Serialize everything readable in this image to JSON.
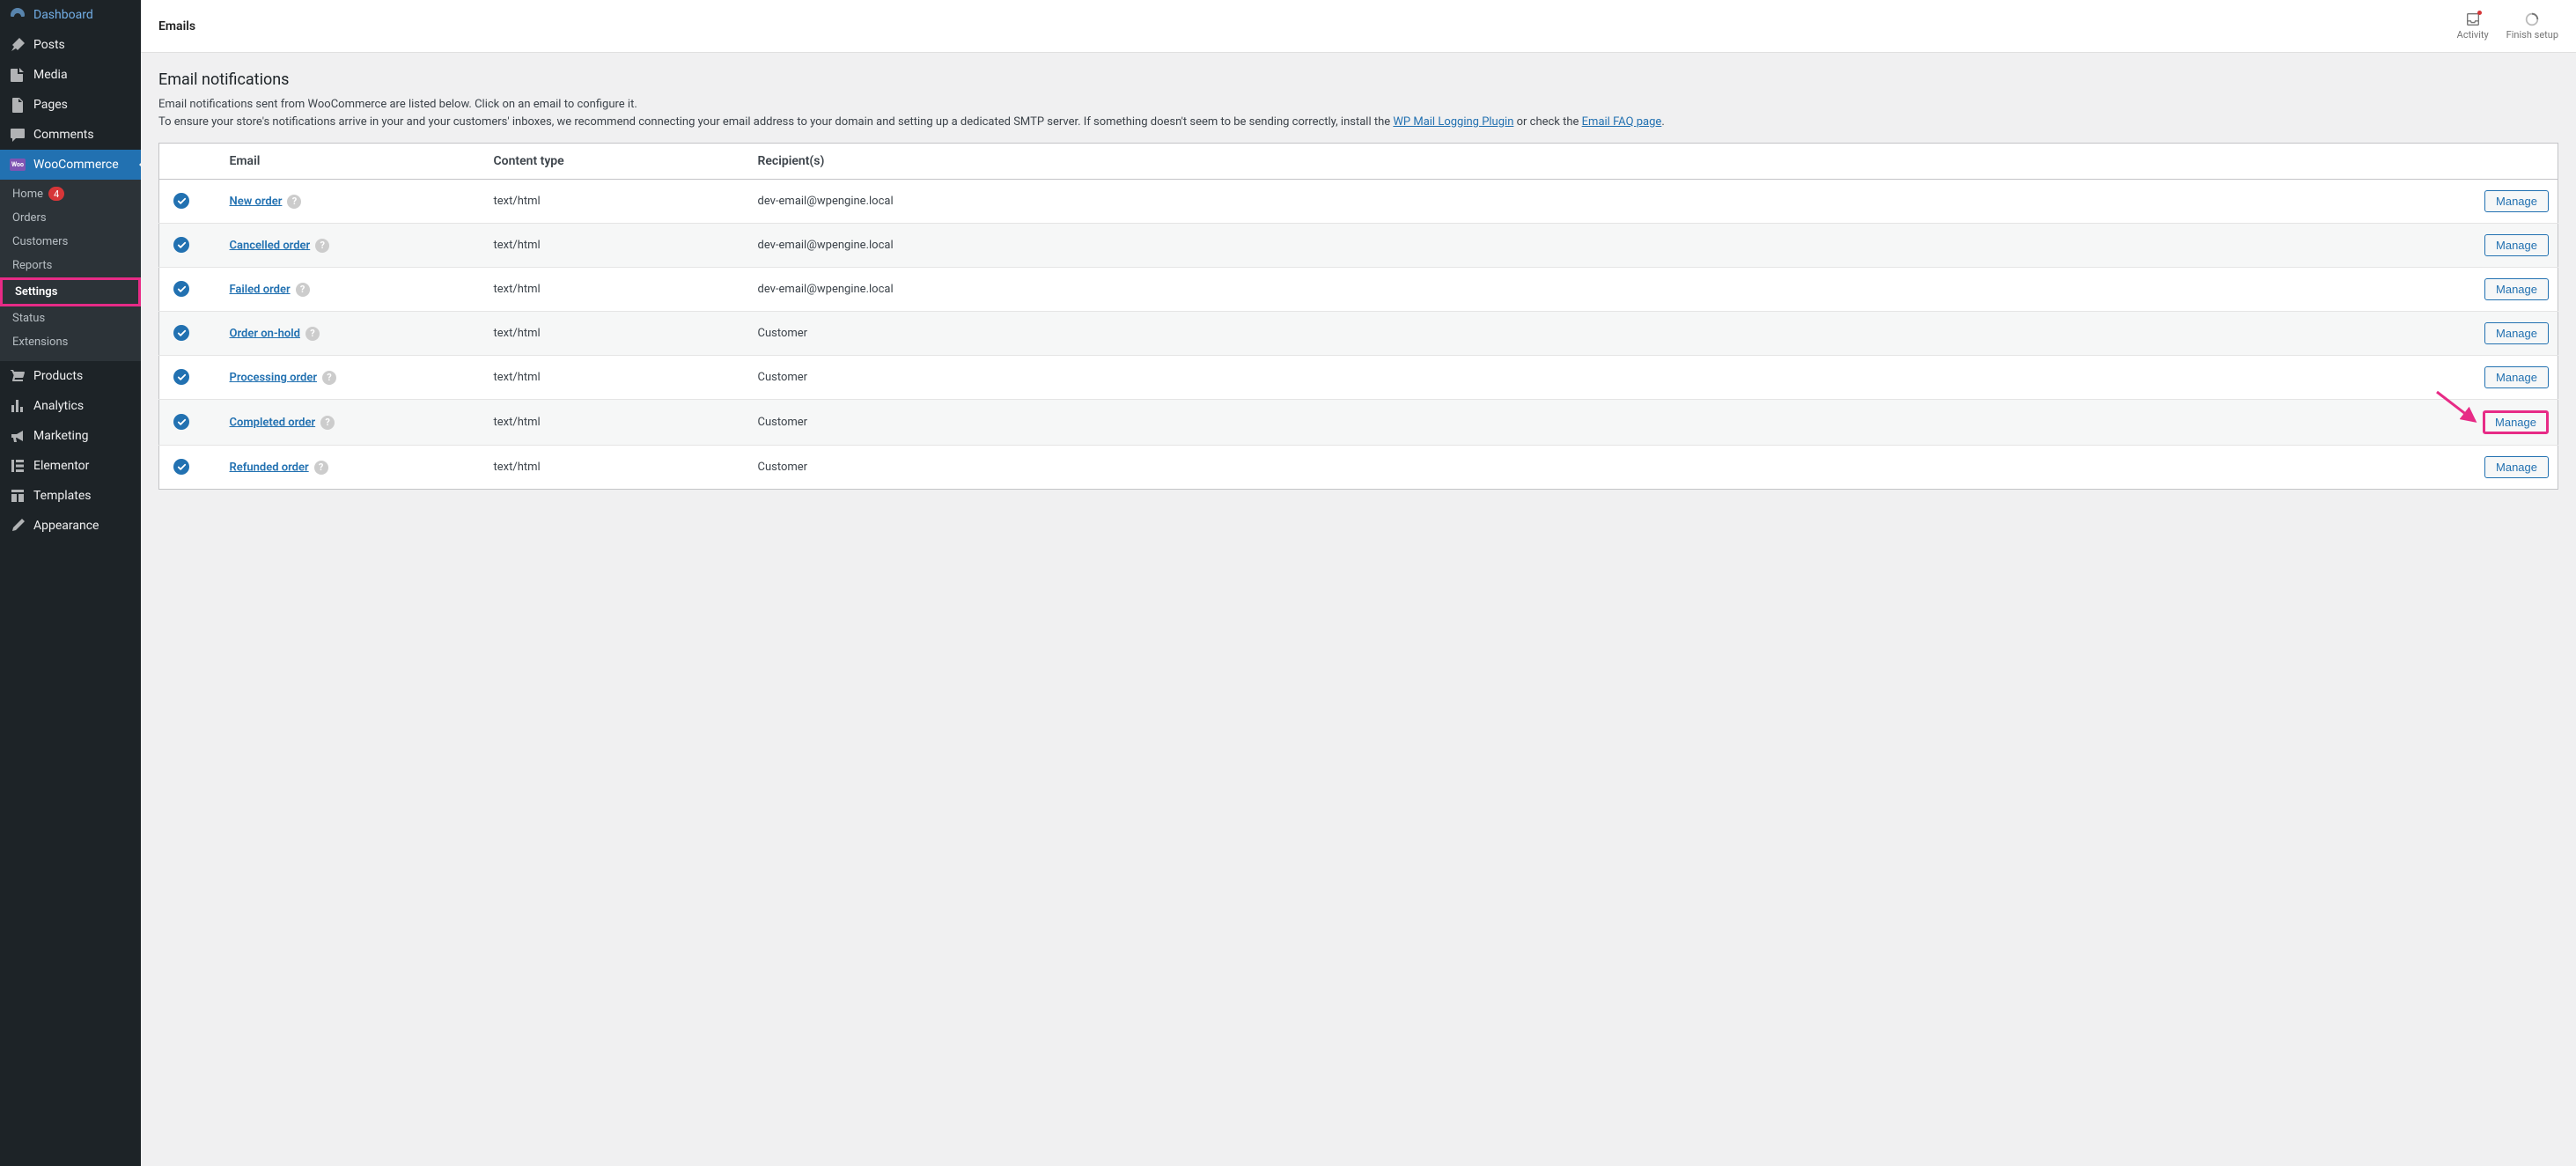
{
  "sidebar": {
    "items": [
      {
        "label": "Dashboard",
        "icon": "dashboard"
      },
      {
        "label": "Posts",
        "icon": "pin"
      },
      {
        "label": "Media",
        "icon": "media"
      },
      {
        "label": "Pages",
        "icon": "pages"
      },
      {
        "label": "Comments",
        "icon": "comments"
      },
      {
        "label": "WooCommerce",
        "icon": "woo",
        "active": true,
        "submenu": [
          {
            "label": "Home",
            "badge": "4"
          },
          {
            "label": "Orders"
          },
          {
            "label": "Customers"
          },
          {
            "label": "Reports"
          },
          {
            "label": "Settings",
            "current": true,
            "highlighted": true
          },
          {
            "label": "Status"
          },
          {
            "label": "Extensions"
          }
        ]
      },
      {
        "label": "Products",
        "icon": "products"
      },
      {
        "label": "Analytics",
        "icon": "analytics"
      },
      {
        "label": "Marketing",
        "icon": "marketing"
      },
      {
        "label": "Elementor",
        "icon": "elementor"
      },
      {
        "label": "Templates",
        "icon": "templates"
      },
      {
        "label": "Appearance",
        "icon": "appearance"
      }
    ]
  },
  "topbar": {
    "title": "Emails",
    "activity_label": "Activity",
    "finish_label": "Finish setup"
  },
  "section": {
    "title": "Email notifications",
    "desc_line1": "Email notifications sent from WooCommerce are listed below. Click on an email to configure it.",
    "desc_line2_pre": "To ensure your store's notifications arrive in your and your customers' inboxes, we recommend connecting your email address to your domain and setting up a dedicated SMTP server. If something doesn't seem to be sending correctly, install the ",
    "link_wpmail": "WP Mail Logging Plugin",
    "desc_line2_mid": " or check the ",
    "link_faq": "Email FAQ page",
    "desc_line2_end": "."
  },
  "table": {
    "headers": {
      "email": "Email",
      "content_type": "Content type",
      "recipients": "Recipient(s)"
    },
    "manage_label": "Manage",
    "rows": [
      {
        "name": "New order",
        "content_type": "text/html",
        "recipient": "dev-email@wpengine.local"
      },
      {
        "name": "Cancelled order",
        "content_type": "text/html",
        "recipient": "dev-email@wpengine.local"
      },
      {
        "name": "Failed order",
        "content_type": "text/html",
        "recipient": "dev-email@wpengine.local"
      },
      {
        "name": "Order on-hold",
        "content_type": "text/html",
        "recipient": "Customer"
      },
      {
        "name": "Processing order",
        "content_type": "text/html",
        "recipient": "Customer"
      },
      {
        "name": "Completed order",
        "content_type": "text/html",
        "recipient": "Customer",
        "highlighted": true
      },
      {
        "name": "Refunded order",
        "content_type": "text/html",
        "recipient": "Customer"
      }
    ]
  }
}
